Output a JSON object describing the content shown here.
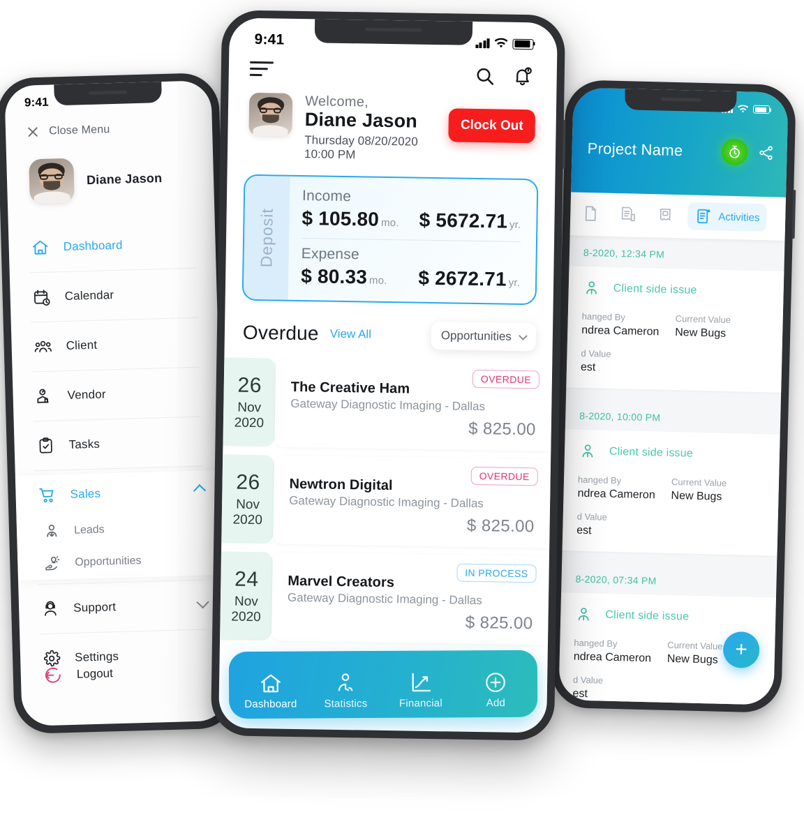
{
  "left_phone": {
    "status": {
      "time": "9:41"
    },
    "close_menu": "Close Menu",
    "user": {
      "name": "Diane Jason"
    },
    "nav": [
      {
        "label": "Dashboard",
        "icon": "home-icon",
        "active": true
      },
      {
        "label": "Calendar",
        "icon": "calendar-clock-icon",
        "active": false
      },
      {
        "label": "Client",
        "icon": "people-group-icon",
        "active": false
      },
      {
        "label": "Vendor",
        "icon": "vendor-icon",
        "active": false
      },
      {
        "label": "Tasks",
        "icon": "clipboard-check-icon",
        "active": false
      },
      {
        "label": "Sales",
        "icon": "shopping-cart-icon",
        "active": true,
        "expanded": true
      },
      {
        "label": "Support",
        "icon": "headset-agent-icon",
        "active": false,
        "expanded": false
      },
      {
        "label": "Settings",
        "icon": "gear-icon",
        "active": false
      }
    ],
    "sales_subitems": [
      {
        "label": "Leads",
        "icon": "lead-person-icon"
      },
      {
        "label": "Opportunities",
        "icon": "hand-bulb-icon"
      }
    ],
    "logout": {
      "label": "Logout",
      "icon": "logout-icon"
    }
  },
  "center_phone": {
    "status": {
      "time": "9:41"
    },
    "menu_icon": "hamburger-icon",
    "top_icons": [
      {
        "name": "search-icon"
      },
      {
        "name": "notification-bell-icon"
      }
    ],
    "welcome": {
      "greeting": "Welcome,",
      "name": "Diane Jason",
      "datetime": "Thursday 08/20/2020 10:00 PM",
      "clock_button": "Clock Out"
    },
    "deposit": {
      "side_label": "Deposit",
      "rows": [
        {
          "label": "Income",
          "monthly": "$ 105.80",
          "monthly_unit": "mo.",
          "yearly": "$ 5672.71",
          "yearly_unit": "yr."
        },
        {
          "label": "Expense",
          "monthly": "$ 80.33",
          "monthly_unit": "mo.",
          "yearly": "$ 2672.71",
          "yearly_unit": "yr."
        }
      ]
    },
    "overdue": {
      "title": "Overdue",
      "view_all": "View All",
      "filter_selected": "Opportunities",
      "items": [
        {
          "day": "26",
          "month": "Nov",
          "year": "2020",
          "name": "The Creative Ham",
          "subtitle": "Gateway Diagnostic Imaging - Dallas",
          "amount": "$ 825.00",
          "badge": "OVERDUE",
          "badge_type": "overdue"
        },
        {
          "day": "26",
          "month": "Nov",
          "year": "2020",
          "name": "Newtron Digital",
          "subtitle": "Gateway Diagnostic Imaging - Dallas",
          "amount": "$ 825.00",
          "badge": "OVERDUE",
          "badge_type": "overdue"
        },
        {
          "day": "24",
          "month": "Nov",
          "year": "2020",
          "name": "Marvel Creators",
          "subtitle": "Gateway Diagnostic Imaging - Dallas",
          "amount": "$ 825.00",
          "badge": "IN PROCESS",
          "badge_type": "process"
        }
      ]
    },
    "bottom_nav": [
      {
        "label": "Dashboard",
        "icon": "home-icon",
        "active": true
      },
      {
        "label": "Statistics",
        "icon": "statistics-person-icon",
        "active": false
      },
      {
        "label": "Financial",
        "icon": "chart-growth-icon",
        "active": false
      },
      {
        "label": "Add",
        "icon": "plus-circle-icon",
        "active": false
      }
    ]
  },
  "right_phone": {
    "status": {
      "time": ""
    },
    "header": {
      "title": "Project Name",
      "timer_icon": "stopwatch-icon",
      "share_icon": "share-icon"
    },
    "tabs": [
      {
        "label": "",
        "icon": "document-icon",
        "active": false
      },
      {
        "label": "",
        "icon": "invoice-icon",
        "active": false
      },
      {
        "label": "",
        "icon": "receipt-icon",
        "active": false
      },
      {
        "label": "Activities",
        "icon": "activities-icon",
        "active": true
      }
    ],
    "activities": [
      {
        "date": "8-2020, 12:34 PM",
        "title": "Client side issue",
        "icon": "person-activity-icon",
        "fields": [
          {
            "label": "hanged By",
            "value": "ndrea Cameron"
          },
          {
            "label": "Current Value",
            "value": "New Bugs"
          },
          {
            "label": "d Value",
            "value": "est"
          }
        ]
      },
      {
        "date": "8-2020, 10:00 PM",
        "title": "Client side issue",
        "icon": "person-activity-icon",
        "fields": [
          {
            "label": "hanged By",
            "value": "ndrea Cameron"
          },
          {
            "label": "Current Value",
            "value": "New Bugs"
          },
          {
            "label": "d Value",
            "value": "est"
          }
        ]
      },
      {
        "date": "8-2020, 07:34 PM",
        "title": "Client side issue",
        "icon": "person-activity-icon",
        "fields": [
          {
            "label": "hanged By",
            "value": "ndrea Cameron"
          },
          {
            "label": "Current Value",
            "value": "New Bugs"
          },
          {
            "label": "d Value",
            "value": "est"
          }
        ]
      }
    ],
    "fab": {
      "label": "+",
      "icon": "plus-icon"
    }
  },
  "colors": {
    "accent_blue": "#2aa8ee",
    "teal": "#2cbcbb",
    "red": "#f81d1d",
    "green_badge": "#3fc0a5",
    "pink": "#e8326d",
    "date_chip": "#e6f5ef"
  }
}
